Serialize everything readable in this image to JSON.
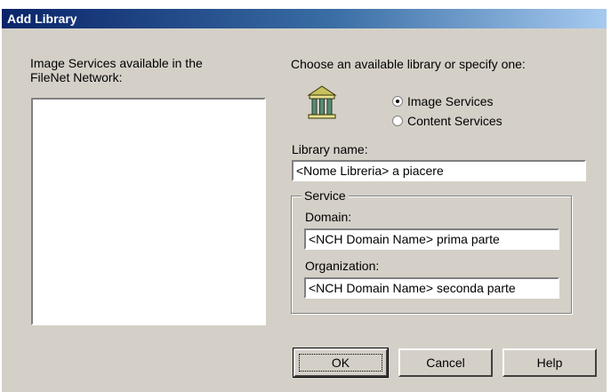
{
  "window": {
    "title": "Add Library"
  },
  "left_panel": {
    "label": "Image Services available in the FileNet Network:"
  },
  "right_panel": {
    "choose_label": "Choose an available library or specify one:",
    "icon": "library-building-icon",
    "options": [
      {
        "label": "Image Services",
        "selected": true
      },
      {
        "label": "Content Services",
        "selected": false
      }
    ],
    "library_name_label": "Library name:",
    "library_name_value": "<Nome Libreria> a piacere",
    "service": {
      "legend": "Service",
      "domain_label": "Domain:",
      "domain_value": "<NCH Domain Name> prima parte",
      "organization_label": "Organization:",
      "organization_value": "<NCH Domain Name> seconda parte"
    }
  },
  "buttons": {
    "ok": "OK",
    "cancel": "Cancel",
    "help": "Help"
  },
  "colors": {
    "face": "#d4d0c8",
    "title_start": "#0a246a",
    "title_end": "#a6caf0"
  }
}
